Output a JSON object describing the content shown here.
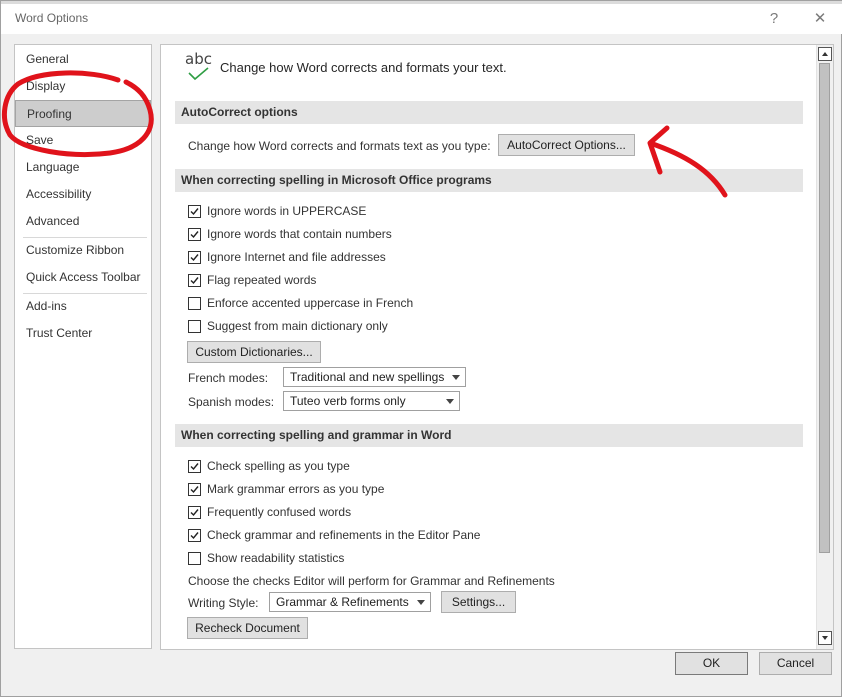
{
  "window": {
    "title": "Word Options",
    "help_glyph": "?",
    "close_glyph": "✕"
  },
  "nav": {
    "items": [
      {
        "label": "General"
      },
      {
        "label": "Display"
      },
      {
        "label": "Proofing",
        "selected": true
      },
      {
        "label": "Save"
      },
      {
        "label": "Language"
      },
      {
        "label": "Accessibility"
      },
      {
        "label": "Advanced"
      },
      {
        "label": "Customize Ribbon"
      },
      {
        "label": "Quick Access Toolbar"
      },
      {
        "label": "Add-ins"
      },
      {
        "label": "Trust Center"
      }
    ]
  },
  "header": {
    "icon_text": "abc",
    "intro": "Change how Word corrects and formats your text."
  },
  "autocorrect": {
    "heading": "AutoCorrect options",
    "label": "Change how Word corrects and formats text as you type:",
    "button": "AutoCorrect Options..."
  },
  "spelling_office": {
    "heading": "When correcting spelling in Microsoft Office programs",
    "options": [
      {
        "label": "Ignore words in UPPERCASE",
        "checked": true
      },
      {
        "label": "Ignore words that contain numbers",
        "checked": true
      },
      {
        "label": "Ignore Internet and file addresses",
        "checked": true
      },
      {
        "label": "Flag repeated words",
        "checked": true
      },
      {
        "label": "Enforce accented uppercase in French",
        "checked": false
      },
      {
        "label": "Suggest from main dictionary only",
        "checked": false
      }
    ],
    "custom_dict_button": "Custom Dictionaries...",
    "french_label": "French modes:",
    "french_value": "Traditional and new spellings",
    "spanish_label": "Spanish modes:",
    "spanish_value": "Tuteo verb forms only"
  },
  "spelling_word": {
    "heading": "When correcting spelling and grammar in Word",
    "options": [
      {
        "label": "Check spelling as you type",
        "checked": true
      },
      {
        "label": "Mark grammar errors as you type",
        "checked": true
      },
      {
        "label": "Frequently confused words",
        "checked": true
      },
      {
        "label": "Check grammar and refinements in the Editor Pane",
        "checked": true
      },
      {
        "label": "Show readability statistics",
        "checked": false
      }
    ],
    "checks_label": "Choose the checks Editor will perform for Grammar and Refinements",
    "writing_style_label": "Writing Style:",
    "writing_style_value": "Grammar & Refinements",
    "settings_button": "Settings...",
    "recheck_button": "Recheck Document"
  },
  "footer": {
    "ok": "OK",
    "cancel": "Cancel"
  },
  "colors": {
    "annotation": "#e0131b",
    "checkmark_green": "#2f9e44"
  }
}
